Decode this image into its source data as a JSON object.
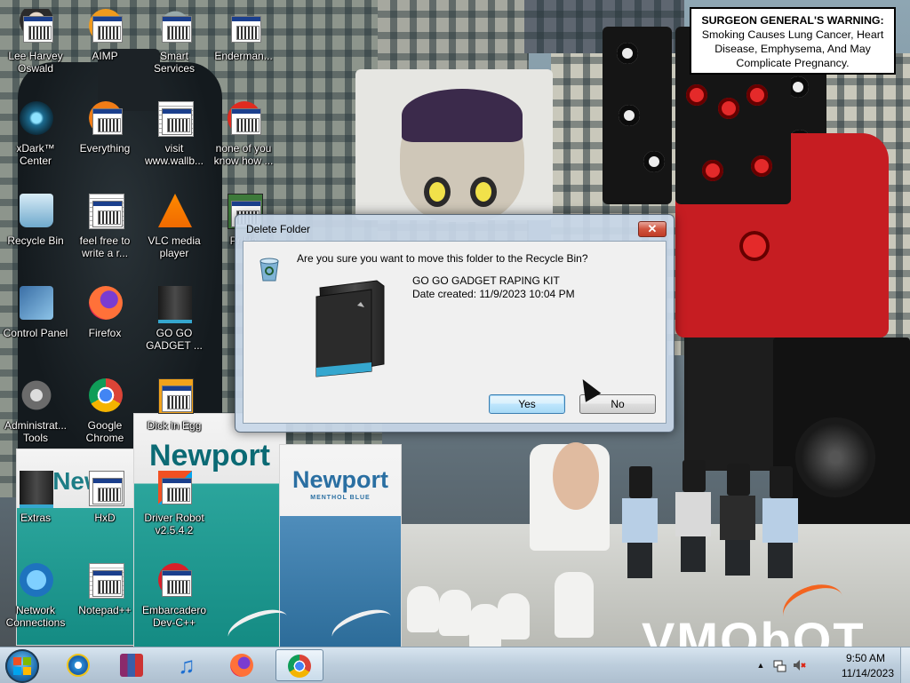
{
  "desktop": {
    "icons": [
      {
        "label": "Lee Harvey Oswald",
        "icon": "person-icon"
      },
      {
        "label": "AIMP",
        "icon": "aimp-icon"
      },
      {
        "label": "Smart Services",
        "icon": "gear-services-icon"
      },
      {
        "label": "Enderman...",
        "icon": "exe-icon"
      },
      {
        "label": "xDark™ Center",
        "icon": "xdark-icon"
      },
      {
        "label": "Everything",
        "icon": "everything-icon"
      },
      {
        "label": "visit www.wallb...",
        "icon": "document-icon"
      },
      {
        "label": "none of you know how ...",
        "icon": "opera-like-icon"
      },
      {
        "label": "Recycle Bin",
        "icon": "recycle-bin-icon"
      },
      {
        "label": "feel free to write a r...",
        "icon": "document-icon"
      },
      {
        "label": "VLC media player",
        "icon": "vlc-icon"
      },
      {
        "label": "Pr Ha",
        "icon": "program-icon"
      },
      {
        "label": "Control Panel",
        "icon": "control-panel-icon"
      },
      {
        "label": "Firefox",
        "icon": "firefox-icon"
      },
      {
        "label": "GO GO GADGET ...",
        "icon": "folder-icon"
      },
      {
        "label": "Administrat... Tools",
        "icon": "admin-tools-icon"
      },
      {
        "label": "Google Chrome",
        "icon": "chrome-icon"
      },
      {
        "label": "Dick in Egg",
        "icon": "de-icon"
      },
      {
        "label": "Extras",
        "icon": "folder-icon"
      },
      {
        "label": "HxD",
        "icon": "hxd-icon"
      },
      {
        "label": "Driver Robot v2.5.4.2",
        "icon": "driver-robot-icon"
      },
      {
        "label": "Network Connections",
        "icon": "network-icon"
      },
      {
        "label": "Notepad++",
        "icon": "notepadpp-icon"
      },
      {
        "label": "Embarcadero Dev-C++",
        "icon": "devcpp-icon"
      }
    ]
  },
  "wallpaper": {
    "warning_bold": "SURGEON GENERAL'S WARNING:",
    "warning_text": " Smoking Causes Lung Cancer, Heart Disease, Emphysema, And May Complicate Pregnancy.",
    "pack_brand": "Newport",
    "pack_sub": "MENTHOL BLUE",
    "pack_partial": "New",
    "watermark": "VMObOT"
  },
  "dialog": {
    "title": "Delete Folder",
    "close_label": "✕",
    "question": "Are you sure you want to move this folder to the Recycle Bin?",
    "folder_name": "GO GO GADGET RAPING KIT",
    "date_created": "Date created: 11/9/2023 10:04 PM",
    "yes_label": "Yes",
    "no_label": "No"
  },
  "taskbar": {
    "pinned": [
      {
        "name": "internet-explorer",
        "icon": "ie-icon"
      },
      {
        "name": "winrar",
        "icon": "winrar-icon"
      },
      {
        "name": "itunes",
        "icon": "music-note-icon"
      },
      {
        "name": "firefox",
        "icon": "firefox-icon"
      },
      {
        "name": "chrome",
        "icon": "chrome-icon"
      }
    ],
    "tray_arrow": "▲",
    "time": "9:50 AM",
    "date": "11/14/2023"
  },
  "colors": {
    "dialog_frame": "#c8d7e8",
    "close_button": "#c8432e",
    "yes_focus": "#3c7fb1",
    "taskbar": "#bccddc"
  }
}
